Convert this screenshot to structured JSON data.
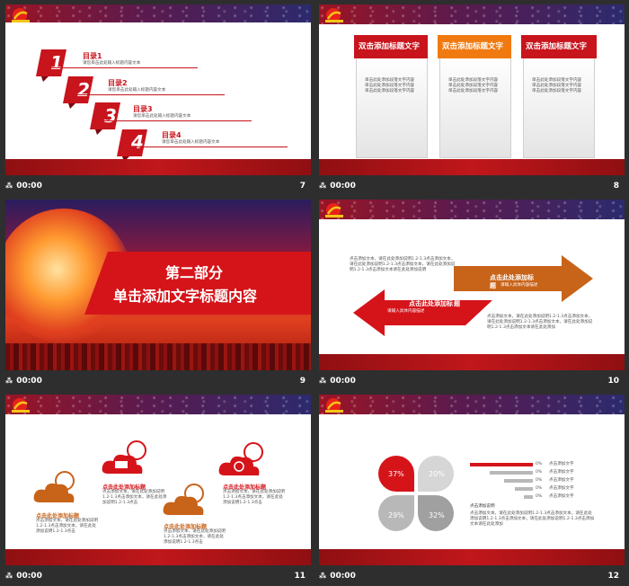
{
  "footer": {
    "time": "00:00",
    "glyph": "⁂"
  },
  "slides": [
    {
      "num": "7",
      "items": [
        {
          "n": "1",
          "title": "目录1",
          "desc": "请您单击此处输入标题内容文本"
        },
        {
          "n": "2",
          "title": "目录2",
          "desc": "请您单击此处输入标题内容文本"
        },
        {
          "n": "3",
          "title": "目录3",
          "desc": "请您单击此处输入标题内容文本"
        },
        {
          "n": "4",
          "title": "目录4",
          "desc": "请您单击此处输入标题内容文本"
        }
      ]
    },
    {
      "num": "8",
      "cards": [
        {
          "title": "双击添加标题文字",
          "body": "单击此处添加段落文字内容\n单击此处添加段落文字内容\n单击此处添加段落文字内容"
        },
        {
          "title": "双击添加标题文字",
          "body": "单击此处添加段落文字内容\n单击此处添加段落文字内容\n单击此处添加段落文字内容"
        },
        {
          "title": "双击添加标题文字",
          "body": "单击此处添加段落文字内容\n单击此处添加段落文字内容\n单击此处添加段落文字内容"
        }
      ]
    },
    {
      "num": "9",
      "part": "第二部分",
      "subtitle": "单击添加文字标题内容"
    },
    {
      "num": "10",
      "right_title": "点击此处添加标",
      "right_title2": "题",
      "right_sub": "请输入具体内容描述",
      "left_title": "点击此处添加标",
      "left_title2": "题",
      "left_sub": "请输入具体内容描述",
      "para1": "点击添加文本，请在此处添加说明1.2-1.3点击添加文本，请在此处添加说明1.2-1.3点击添加文本，请在此处添加说明1.2-1.3点击添加文本请在此处添加说明",
      "para2": "点击添加文本，请在此处添加说明1.2-1.3点击添加文本，请在此处添加说明1.2-1.3点击添加文本，请在此处添加说明1.2-1.3点击添加文本请在此处添加"
    },
    {
      "num": "11",
      "items": [
        {
          "title": "点击此处添加标题",
          "body": "点击添加文本，请在此处添加说明1.2-1.3点击添加文本，请在此处添加说明1.2-1.3点击"
        },
        {
          "title": "点击此处添加标题",
          "body": "点击添加文本，请在此处添加说明1.2-1.3点击添加文本，请在此处添加说明1.2-1.3点击"
        },
        {
          "title": "点击此处添加标题",
          "body": "点击添加文本，请在此处添加说明1.2-1.3点击添加文本，请在此处添加说明1.2-1.3点击"
        },
        {
          "title": "点击此处添加标题",
          "body": "点击添加文本，请在此处添加说明1.2-1.3点击添加文本，请在此处添加说明1.2-1.3点击"
        }
      ]
    },
    {
      "num": "12",
      "petals": [
        "37%",
        "20%",
        "29%",
        "32%"
      ],
      "bars": [
        {
          "pct": "0%",
          "label": "点击添加文字"
        },
        {
          "pct": "0%",
          "label": "点击添加文字"
        },
        {
          "pct": "0%",
          "label": "点击添加文字"
        },
        {
          "pct": "0%",
          "label": "点击添加文字"
        },
        {
          "pct": "0%",
          "label": "点击添加文字"
        }
      ],
      "para_title": "点击添加说明",
      "para": "点击添加文本，请在此处添加说明1.2-1.3点击添加文本，请在此处添加说明1.2-1.3点击添加文本，请在此处添加说明1.2-1.3点击添加文本请在此处添加"
    }
  ]
}
